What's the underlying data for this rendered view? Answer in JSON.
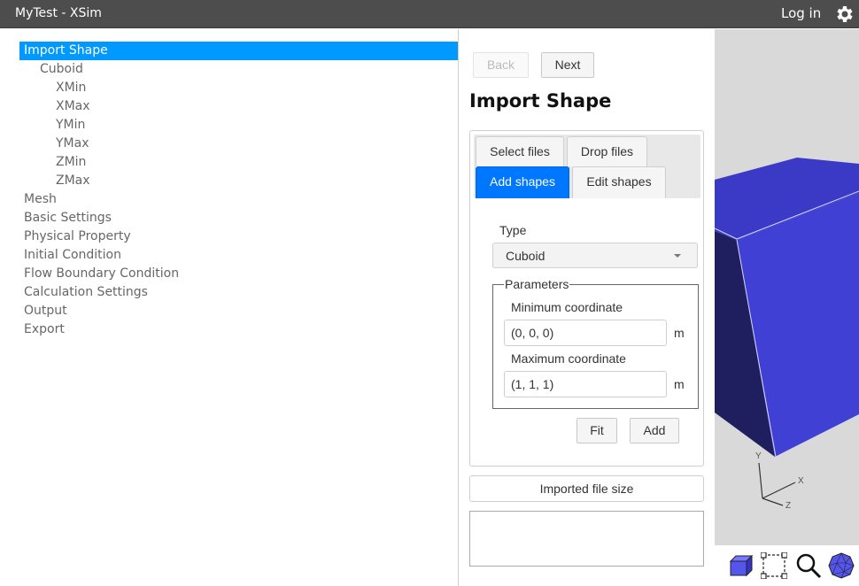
{
  "app": {
    "title": "MyTest - XSim",
    "login_label": "Log in",
    "settings_icon": "gear-icon"
  },
  "tree": {
    "items": [
      {
        "label": "Import Shape",
        "level": 0,
        "selected": true
      },
      {
        "label": "Cuboid",
        "level": 1,
        "selected": false
      },
      {
        "label": "XMin",
        "level": 2,
        "selected": false
      },
      {
        "label": "XMax",
        "level": 2,
        "selected": false
      },
      {
        "label": "YMin",
        "level": 2,
        "selected": false
      },
      {
        "label": "YMax",
        "level": 2,
        "selected": false
      },
      {
        "label": "ZMin",
        "level": 2,
        "selected": false
      },
      {
        "label": "ZMax",
        "level": 2,
        "selected": false
      },
      {
        "label": "Mesh",
        "level": 0,
        "selected": false
      },
      {
        "label": "Basic Settings",
        "level": 0,
        "selected": false
      },
      {
        "label": "Physical Property",
        "level": 0,
        "selected": false
      },
      {
        "label": "Initial Condition",
        "level": 0,
        "selected": false
      },
      {
        "label": "Flow Boundary Condition",
        "level": 0,
        "selected": false
      },
      {
        "label": "Calculation Settings",
        "level": 0,
        "selected": false
      },
      {
        "label": "Output",
        "level": 0,
        "selected": false
      },
      {
        "label": "Export",
        "level": 0,
        "selected": false
      }
    ]
  },
  "panel": {
    "back_label": "Back",
    "back_disabled": true,
    "next_label": "Next",
    "title": "Import Shape",
    "tabs": [
      {
        "label": "Select files",
        "active": false
      },
      {
        "label": "Drop files",
        "active": false
      },
      {
        "label": "Add shapes",
        "active": true
      },
      {
        "label": "Edit shapes",
        "active": false
      }
    ],
    "type_label": "Type",
    "type_value": "Cuboid",
    "parameters_legend": "Parameters",
    "min_label": "Minimum coordinate",
    "min_value": "(0, 0, 0)",
    "min_unit": "m",
    "max_label": "Maximum coordinate",
    "max_value": "(1, 1, 1)",
    "max_unit": "m",
    "fit_label": "Fit",
    "add_label": "Add",
    "file_size_label": "Imported file size",
    "file_size_value": ""
  },
  "viewport": {
    "background": "#d9d9d9",
    "shape_color": "#4040d4",
    "axes": {
      "x": "X",
      "y": "Y",
      "z": "Z"
    }
  },
  "toolbar": {
    "tools": [
      "cube-view-icon",
      "box-select-icon",
      "zoom-icon",
      "mesh-view-icon"
    ]
  }
}
